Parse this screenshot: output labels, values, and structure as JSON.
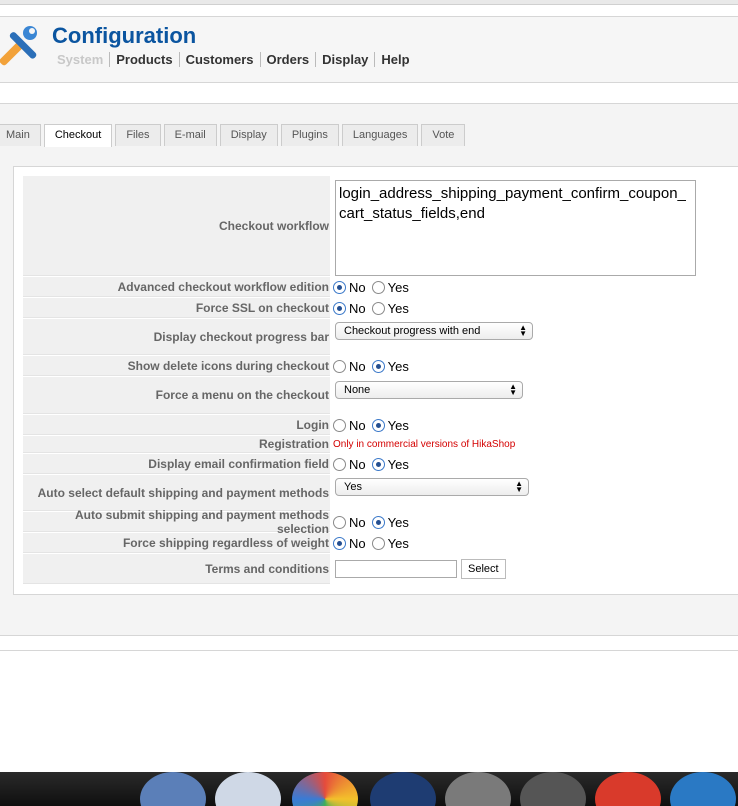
{
  "header": {
    "title": "Configuration",
    "menu": [
      "System",
      "Products",
      "Customers",
      "Orders",
      "Display",
      "Help"
    ]
  },
  "tabs": [
    "Main",
    "Checkout",
    "Files",
    "E-mail",
    "Display",
    "Plugins",
    "Languages",
    "Vote"
  ],
  "active_tab": "Checkout",
  "form": {
    "checkout_workflow": {
      "label": "Checkout workflow",
      "value": "login_address_shipping_payment_confirm_coupon_cart_status_fields,end"
    },
    "advanced_workflow": {
      "label": "Advanced checkout workflow edition",
      "selected": "No"
    },
    "force_ssl": {
      "label": "Force SSL on checkout",
      "selected": "No"
    },
    "progress_bar": {
      "label": "Display checkout progress bar",
      "value": "Checkout progress with end"
    },
    "delete_icons": {
      "label": "Show delete icons during checkout",
      "selected": "Yes"
    },
    "force_menu": {
      "label": "Force a menu on the checkout",
      "value": "None"
    },
    "login": {
      "label": "Login",
      "selected": "Yes"
    },
    "registration": {
      "label": "Registration",
      "note": "Only in commercial versions of HikaShop"
    },
    "email_confirmation": {
      "label": "Display email confirmation field",
      "selected": "Yes"
    },
    "auto_select": {
      "label": "Auto select default shipping and payment methods",
      "value": "Yes"
    },
    "auto_submit": {
      "label": "Auto submit shipping and payment methods selection",
      "selected": "Yes"
    },
    "force_shipping": {
      "label": "Force shipping regardless of weight",
      "selected": "No"
    },
    "terms": {
      "label": "Terms and conditions",
      "value": "",
      "button": "Select"
    }
  },
  "radio_labels": {
    "no": "No",
    "yes": "Yes"
  },
  "colors": {
    "title": "#0b55a0",
    "note": "#d40000"
  }
}
